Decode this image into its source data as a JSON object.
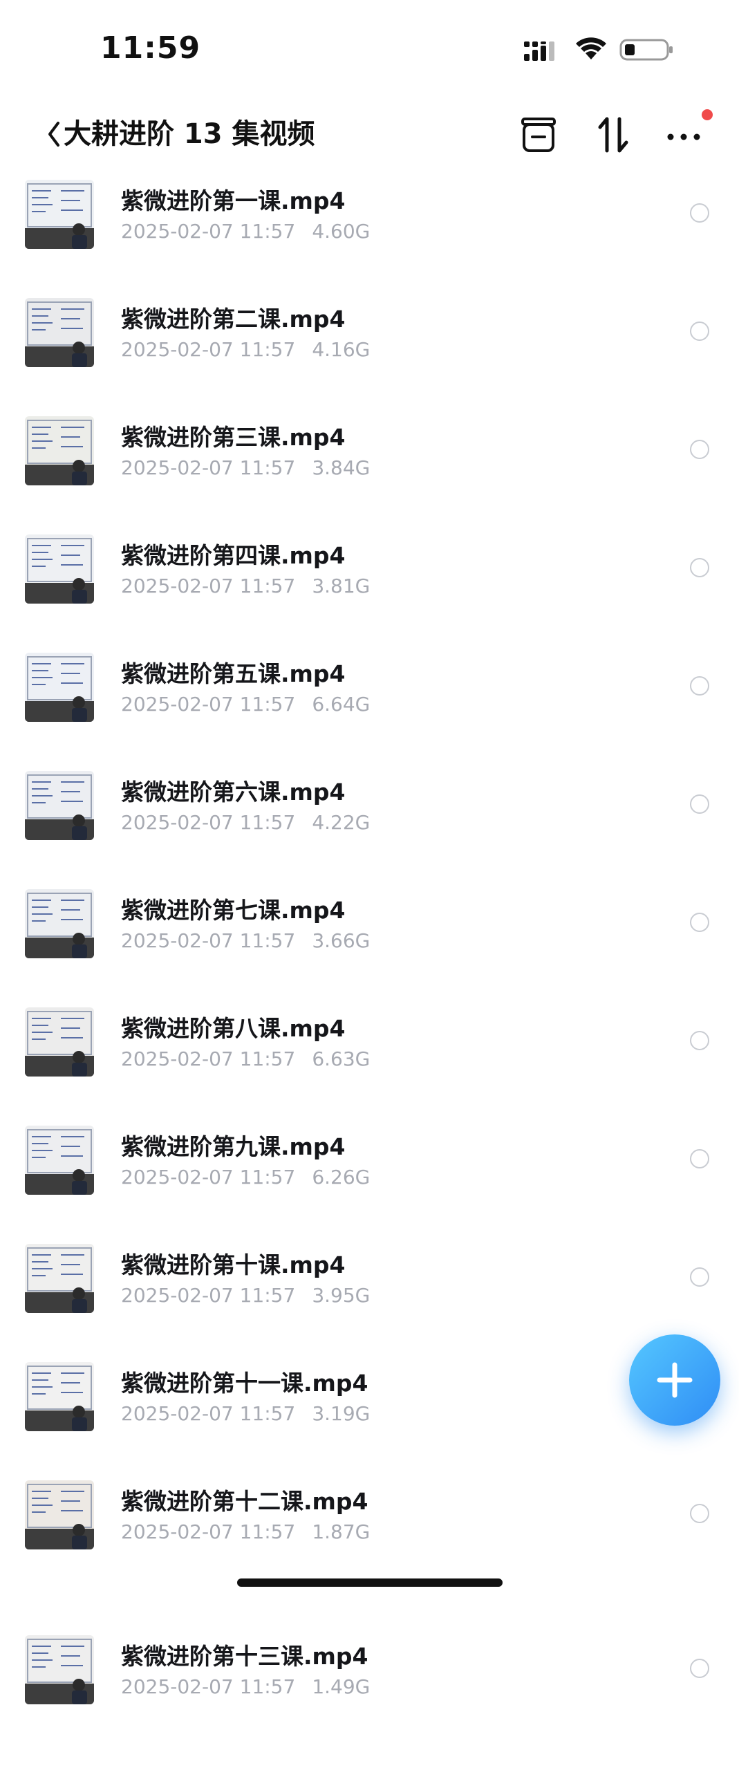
{
  "status_bar": {
    "time": "11:59"
  },
  "header": {
    "title": "大耕进阶 13 集视频"
  },
  "colors": {
    "accent": "#2f8df5",
    "notification": "#f04a4a",
    "meta_text": "#a7aab2"
  },
  "icons": {
    "back": "chevron-left-icon",
    "recycle": "box-icon",
    "sort": "sort-arrows-icon",
    "more": "ellipsis-icon",
    "add": "plus-icon"
  },
  "files": [
    {
      "name": "紫微进阶第一课.mp4",
      "date": "2025-02-07 11:57",
      "size": "4.60G"
    },
    {
      "name": "紫微进阶第二课.mp4",
      "date": "2025-02-07 11:57",
      "size": "4.16G"
    },
    {
      "name": "紫微进阶第三课.mp4",
      "date": "2025-02-07 11:57",
      "size": "3.84G"
    },
    {
      "name": "紫微进阶第四课.mp4",
      "date": "2025-02-07 11:57",
      "size": "3.81G"
    },
    {
      "name": "紫微进阶第五课.mp4",
      "date": "2025-02-07 11:57",
      "size": "6.64G"
    },
    {
      "name": "紫微进阶第六课.mp4",
      "date": "2025-02-07 11:57",
      "size": "4.22G"
    },
    {
      "name": "紫微进阶第七课.mp4",
      "date": "2025-02-07 11:57",
      "size": "3.66G"
    },
    {
      "name": "紫微进阶第八课.mp4",
      "date": "2025-02-07 11:57",
      "size": "6.63G"
    },
    {
      "name": "紫微进阶第九课.mp4",
      "date": "2025-02-07 11:57",
      "size": "6.26G"
    },
    {
      "name": "紫微进阶第十课.mp4",
      "date": "2025-02-07 11:57",
      "size": "3.95G"
    },
    {
      "name": "紫微进阶第十一课.mp4",
      "date": "2025-02-07 11:57",
      "size": "3.19G"
    },
    {
      "name": "紫微进阶第十二课.mp4",
      "date": "2025-02-07 11:57",
      "size": "1.87G"
    },
    {
      "name": "紫微进阶第十三课.mp4",
      "date": "2025-02-07 11:57",
      "size": "1.49G"
    }
  ]
}
